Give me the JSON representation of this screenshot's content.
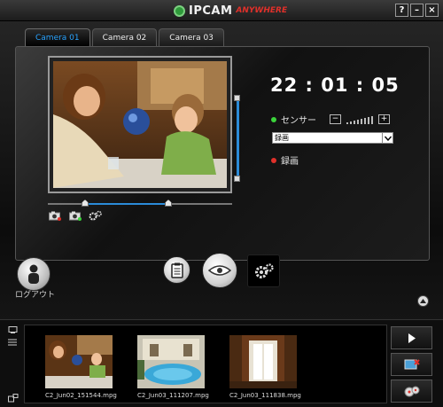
{
  "titlebar": {
    "logo_text": "IPCAM",
    "logo_sub": "ANYWHERE",
    "buttons": [
      "?",
      "–",
      "×"
    ]
  },
  "tabs": [
    {
      "label": "Camera 01",
      "active": true
    },
    {
      "label": "Camera 02",
      "active": false
    },
    {
      "label": "Camera 03",
      "active": false
    }
  ],
  "clock": "22 : 01 : 05",
  "sensor": {
    "label": "センサー",
    "minus": "−",
    "plus": "+",
    "indicator_color": "#3bd43b"
  },
  "select": {
    "value": "録画"
  },
  "record": {
    "label": "録画",
    "indicator_color": "#e0302a"
  },
  "logout": {
    "label": "ログアウト"
  },
  "thumbnails": [
    {
      "label": "C2_Jun02_151544.mpg"
    },
    {
      "label": "C2_Jun03_111207.mpg"
    },
    {
      "label": "C2_Jun03_111838.mpg"
    }
  ],
  "colors": {
    "accent": "#2b8bd8",
    "tab_active": "#2aa4ff"
  }
}
